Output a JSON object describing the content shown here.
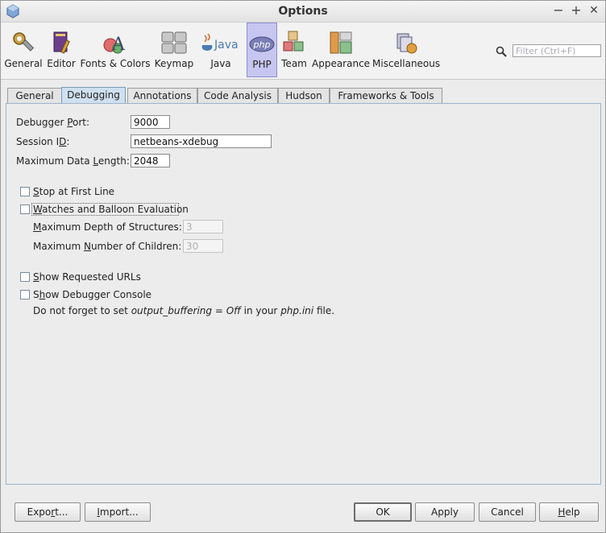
{
  "window": {
    "title": "Options",
    "controls": {
      "minimize": "−",
      "maximize": "+",
      "close": "✕"
    }
  },
  "toolbar": {
    "categories": [
      {
        "label": "General",
        "icon": "general-icon"
      },
      {
        "label": "Editor",
        "icon": "editor-icon"
      },
      {
        "label": "Fonts & Colors",
        "icon": "fonts-colors-icon"
      },
      {
        "label": "Keymap",
        "icon": "keymap-icon"
      },
      {
        "label": "Java",
        "icon": "java-icon"
      },
      {
        "label": "PHP",
        "icon": "php-icon",
        "selected": true
      },
      {
        "label": "Team",
        "icon": "team-icon"
      },
      {
        "label": "Appearance",
        "icon": "appearance-icon"
      },
      {
        "label": "Miscellaneous",
        "icon": "miscellaneous-icon"
      }
    ],
    "filter_placeholder": "Filter (Ctrl+F)"
  },
  "tabs": [
    {
      "label": "General"
    },
    {
      "label": "Debugging",
      "selected": true
    },
    {
      "label": "Annotations"
    },
    {
      "label": "Code Analysis"
    },
    {
      "label": "Hudson"
    },
    {
      "label": "Frameworks & Tools"
    }
  ],
  "debugging": {
    "debugger_port": {
      "label_pre": "Debugger ",
      "label_u": "P",
      "label_post": "ort:",
      "value": "9000"
    },
    "session_id": {
      "label_pre": "Session I",
      "label_u": "D",
      "label_post": ":",
      "value": "netbeans-xdebug"
    },
    "max_data_length": {
      "label_pre": "Maximum Data ",
      "label_u": "L",
      "label_post": "ength:",
      "value": "2048"
    },
    "stop_first_line": {
      "label_u": "S",
      "label_post": "top at First Line",
      "checked": false
    },
    "watches": {
      "label_u": "W",
      "label_post": "atches and Balloon Evaluation",
      "checked": false
    },
    "max_depth": {
      "label_u": "M",
      "label_post": "aximum Depth of Structures:",
      "value": "3"
    },
    "max_children": {
      "label_pre": "Maximum ",
      "label_u": "N",
      "label_post": "umber of Children:",
      "value": "30"
    },
    "show_urls": {
      "label_u": "S",
      "label_post": "how Requested URLs",
      "checked": false
    },
    "show_console": {
      "label_pre": "S",
      "label_u": "h",
      "label_post": "ow Debugger Console",
      "checked": false
    },
    "note": {
      "pre": "Do not forget to set ",
      "em1": "output_buffering = Off",
      "mid": " in your ",
      "em2": "php.ini",
      "post": " file."
    }
  },
  "footer": {
    "export_pre": "Expo",
    "export_u": "r",
    "export_post": "t...",
    "import_u": "I",
    "import_post": "mport...",
    "ok": "OK",
    "apply": "Apply",
    "cancel": "Cancel",
    "help_u": "H",
    "help_post": "elp"
  },
  "colors": {
    "selected_category": "#c7c6f0",
    "selected_tab": "#cfe0f0",
    "panel_border": "#9fb3c8"
  }
}
